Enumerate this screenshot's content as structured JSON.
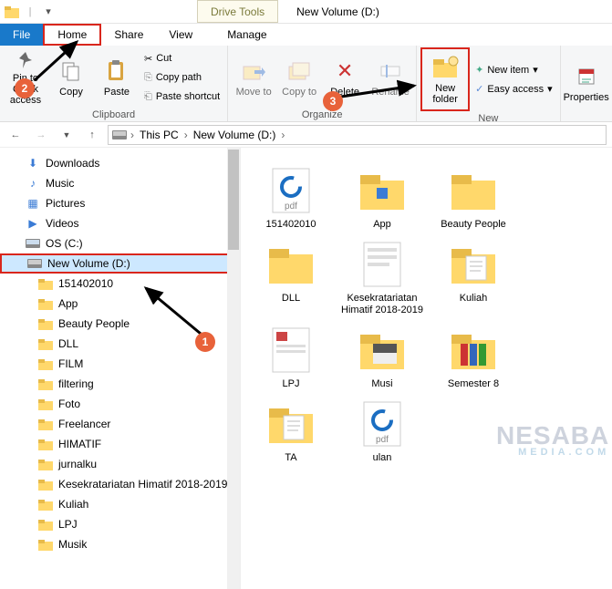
{
  "title": {
    "drive_tools": "Drive Tools",
    "window": "New Volume (D:)"
  },
  "tabs": {
    "file": "File",
    "home": "Home",
    "share": "Share",
    "view": "View",
    "manage": "Manage"
  },
  "ribbon": {
    "pin": "Pin to Quick access",
    "copy": "Copy",
    "paste": "Paste",
    "cut": "Cut",
    "copypath": "Copy path",
    "pastesc": "Paste shortcut",
    "clipboard": "Clipboard",
    "moveto": "Move to",
    "copyto": "Copy to",
    "delete": "Delete",
    "rename": "Rename",
    "organize": "Organize",
    "newfolder": "New folder",
    "newitem": "New item",
    "easyaccess": "Easy access",
    "new": "New",
    "properties": "Properties"
  },
  "breadcrumb": {
    "pc": "This PC",
    "vol": "New Volume (D:)"
  },
  "tree": {
    "downloads": "Downloads",
    "music": "Music",
    "pictures": "Pictures",
    "videos": "Videos",
    "osc": "OS (C:)",
    "nvd": "New Volume (D:)",
    "sub": [
      "151402010",
      "App",
      "Beauty People",
      "DLL",
      "FILM",
      "filtering",
      "Foto",
      "Freelancer",
      "HIMATIF",
      "jurnalku",
      "Kesekratariatan Himatif 2018-2019",
      "Kuliah",
      "LPJ",
      "Musik"
    ]
  },
  "items": [
    "151402010",
    "App",
    "Beauty People",
    "DLL",
    "Kesekratariatan Himatif 2018-2019",
    "Kuliah",
    "LPJ",
    "Musi",
    "Semester 8",
    "TA",
    "ulan"
  ],
  "watermark": {
    "main": "NESABA",
    "sub": "MEDIA.COM"
  }
}
